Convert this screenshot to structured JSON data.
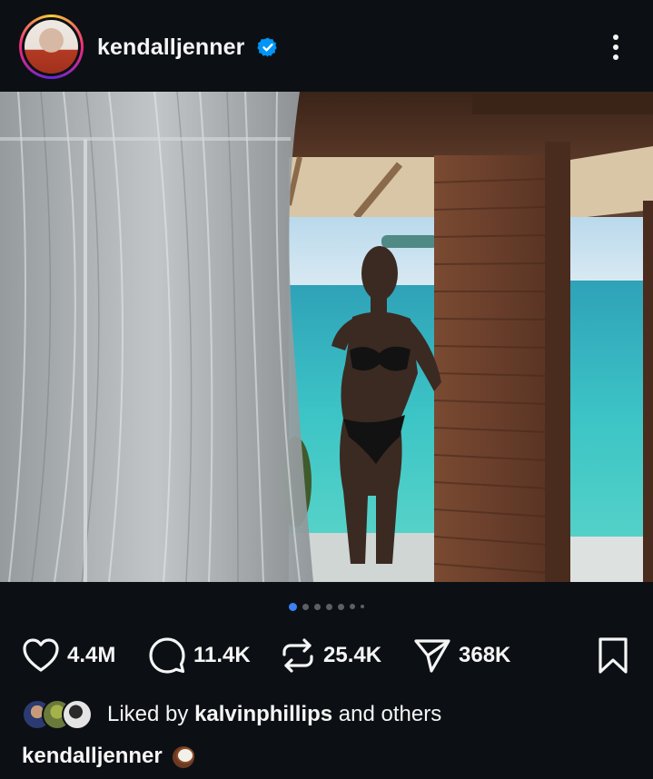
{
  "post": {
    "username": "kendalljenner",
    "verified": true,
    "carousel": {
      "total": 7,
      "active_index": 0
    }
  },
  "actions": {
    "likes": "4.4M",
    "comments": "11.4K",
    "reposts": "25.4K",
    "shares": "368K"
  },
  "liked_by": {
    "prefix": "Liked by",
    "user": "kalvinphillips",
    "suffix": "and others"
  },
  "caption": {
    "username": "kendalljenner",
    "emoji_icon": "coconut-icon"
  },
  "colors": {
    "background": "#0c1014",
    "text": "#f5f5f5",
    "verified_blue": "#0095f6",
    "dot_active": "#3b82f6",
    "dot_inactive": "#5c5f63"
  }
}
